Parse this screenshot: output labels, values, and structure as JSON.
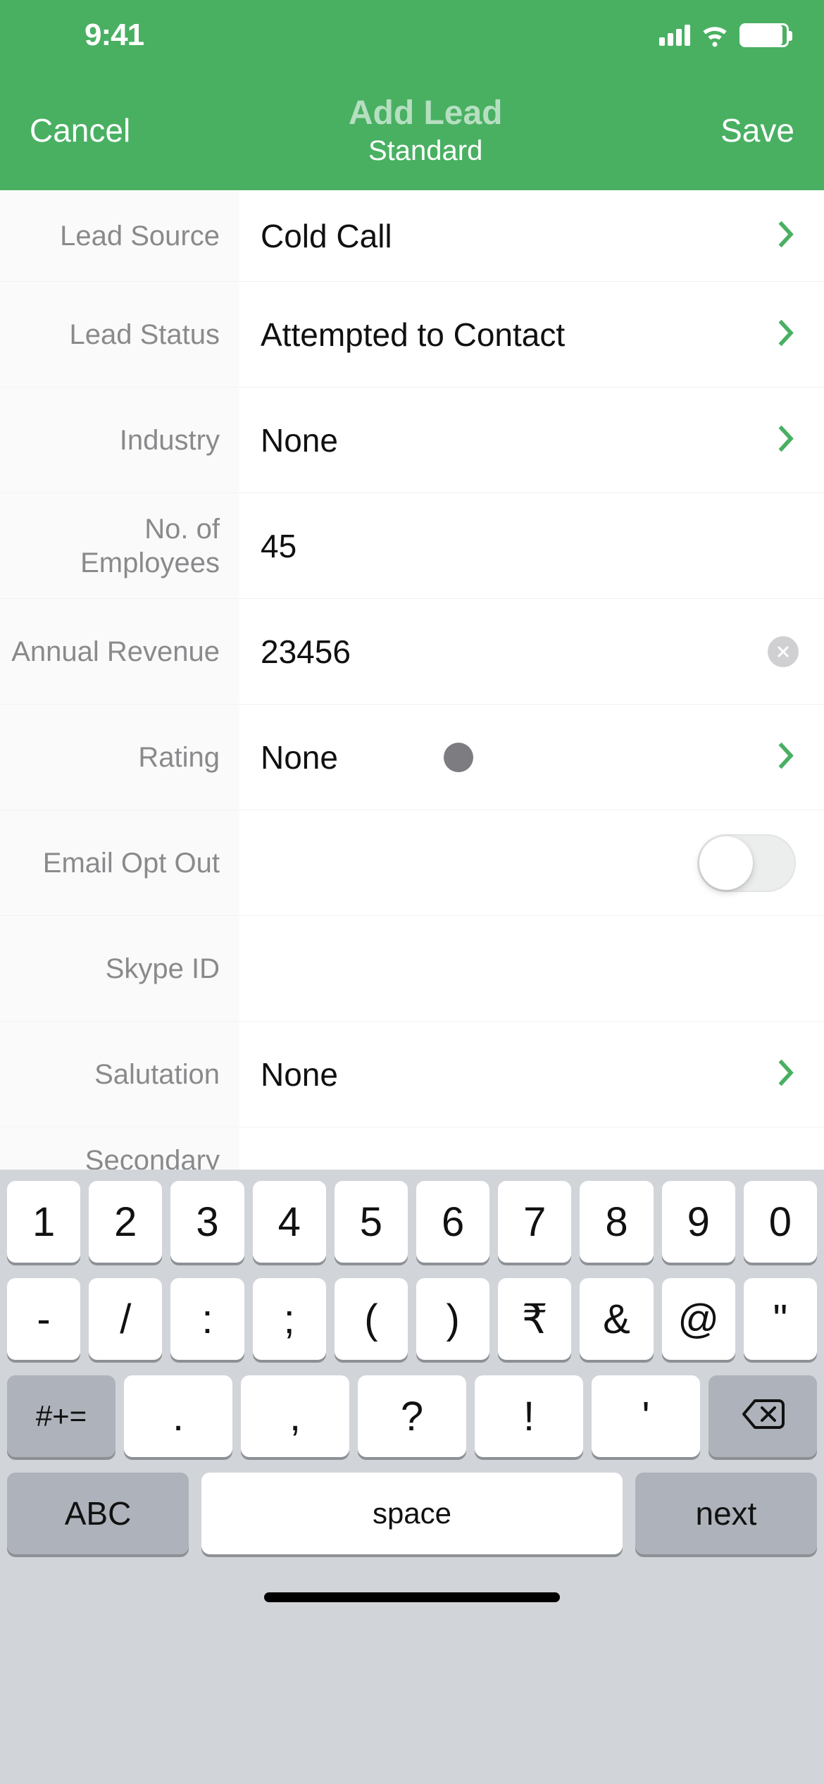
{
  "status": {
    "time": "9:41"
  },
  "nav": {
    "cancel": "Cancel",
    "title": "Add Lead",
    "subtitle": "Standard",
    "save": "Save"
  },
  "fields": {
    "lead_source": {
      "label": "Lead Source",
      "value": "Cold Call"
    },
    "lead_status": {
      "label": "Lead Status",
      "value": "Attempted to Contact"
    },
    "industry": {
      "label": "Industry",
      "value": "None"
    },
    "no_employees": {
      "label": "No. of Employees",
      "value": "45"
    },
    "annual_revenue": {
      "label": "Annual Revenue",
      "value": "23456"
    },
    "rating": {
      "label": "Rating",
      "value": "None"
    },
    "email_opt_out": {
      "label": "Email Opt Out",
      "value": ""
    },
    "skype_id": {
      "label": "Skype ID",
      "value": ""
    },
    "salutation": {
      "label": "Salutation",
      "value": "None"
    },
    "secondary": {
      "label": "Secondary",
      "value": ""
    }
  },
  "keyboard": {
    "row1": [
      "1",
      "2",
      "3",
      "4",
      "5",
      "6",
      "7",
      "8",
      "9",
      "0"
    ],
    "row2": [
      "-",
      "/",
      ":",
      ";",
      "(",
      ")",
      "₹",
      "&",
      "@",
      "\""
    ],
    "mods": "#+=",
    "row3": [
      ".",
      ",",
      "?",
      "!",
      "'"
    ],
    "abc": "ABC",
    "space": "space",
    "next": "next"
  }
}
